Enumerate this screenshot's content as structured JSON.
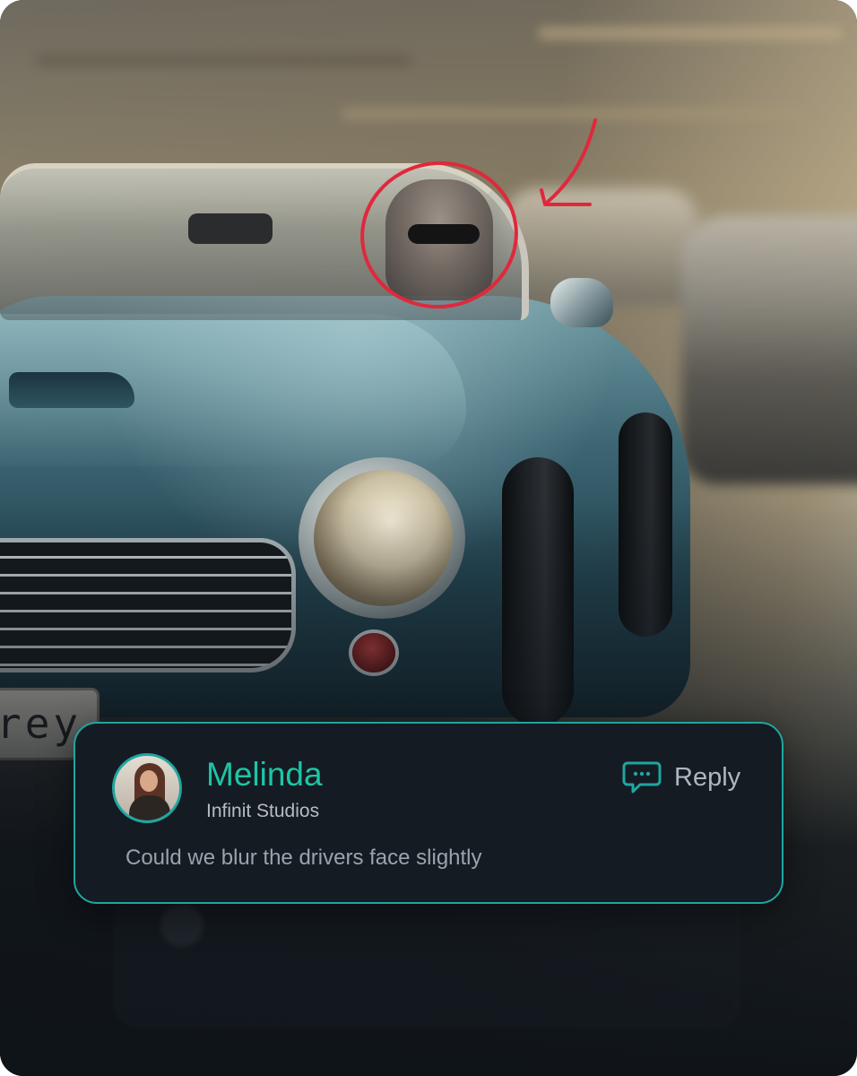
{
  "image": {
    "plate_partial": "rey"
  },
  "comment": {
    "author": "Melinda",
    "company": "Infinit Studios",
    "text": "Could we blur the drivers face slightly",
    "reply_label": "Reply",
    "accent_color": "#1fa6a0",
    "name_color": "#1ec4a6",
    "avatar_icon": "user-avatar",
    "reply_icon": "chat-bubble-icon"
  },
  "annotation": {
    "color": "#e0283c",
    "shapes": [
      "circle-markup",
      "arrow-markup"
    ]
  }
}
